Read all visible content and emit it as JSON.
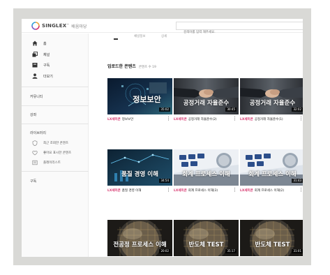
{
  "header": {
    "logo_text": "SINGLEX",
    "logo_tm": "™",
    "logo_sub": "배움마당",
    "search_placeholder": "검색어를 입력 해주세요."
  },
  "sidebar": {
    "nav": [
      {
        "label": "홈",
        "icon": "home-icon"
      },
      {
        "label": "채널",
        "icon": "channel-icon"
      },
      {
        "label": "구독",
        "icon": "subscription-icon"
      },
      {
        "label": "더보기",
        "icon": "person-icon"
      }
    ],
    "community": "커뮤니티",
    "lecture": "강좌",
    "library_title": "라이브러리",
    "library": [
      {
        "label": "최근 조회한 콘텐츠",
        "icon": "shield-icon"
      },
      {
        "label": "좋아요 표시한 콘텐츠",
        "icon": "heart-icon"
      },
      {
        "label": "플레이리스트",
        "icon": "playlist-icon"
      }
    ],
    "subscribe": "구독"
  },
  "main": {
    "tabs": [
      "",
      "채널정보",
      "상세"
    ],
    "section_title": "업로드한 콘텐츠",
    "section_count": "콘텐츠 수 19",
    "cards": [
      {
        "thumb_title": "정보보안",
        "duration": "35:02",
        "brand": "LX세미콘",
        "title": "정보보안",
        "theme": "security"
      },
      {
        "thumb_title": "공정거래 자율준수",
        "duration": "30:45",
        "brand": "LX세미콘",
        "title": "공정거래 자율준수(2)",
        "theme": "handshake"
      },
      {
        "thumb_title": "공정거래 자율준수",
        "duration": "32:02",
        "brand": "LX세미콘",
        "title": "공정거래 자율준수(1)",
        "theme": "handshake"
      },
      {
        "thumb_title": "품질 경영 이해",
        "duration": "34:54",
        "brand": "LX세미콘",
        "title": "품질 경영 이해",
        "theme": "quality"
      },
      {
        "thumb_title": "회계 프로세스 이해",
        "duration": "",
        "brand": "LX세미콘",
        "title": "회계 프로세스 이해(3)",
        "theme": "accounting"
      },
      {
        "thumb_title": "회계 프로세스 이해",
        "duration": "31:43",
        "brand": "LX세미콘",
        "title": "회계 프로세스 이해(2)",
        "theme": "accounting"
      },
      {
        "thumb_title": "전공정 프로세스 이해",
        "duration": "20:02",
        "brand": "LX세미콘",
        "title": "전공정 프로세스 이해(1)",
        "theme": "wafer"
      },
      {
        "thumb_title": "반도체 TEST",
        "duration": "35:17",
        "brand": "LX세미콘",
        "title": "반도체 Test(2)",
        "theme": "wafer"
      },
      {
        "thumb_title": "반도체 TEST",
        "duration": "31:01",
        "brand": "LX세미콘",
        "title": "반도체 Test(1)",
        "theme": "wafer"
      }
    ]
  }
}
